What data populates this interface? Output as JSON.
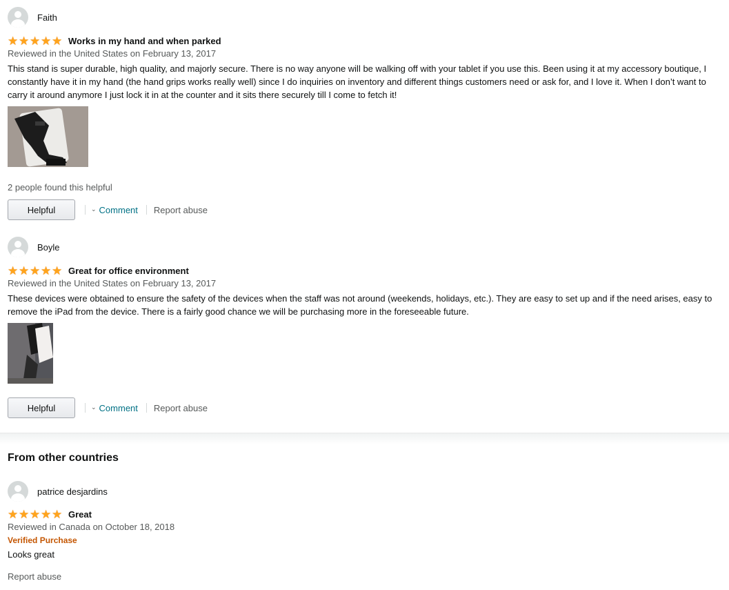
{
  "reviews": [
    {
      "name": "Faith",
      "rating": 5,
      "title": "Works in my hand and when parked",
      "date": "Reviewed in the United States on February 13, 2017",
      "body": "This stand is super durable, high quality, and majorly secure. There is no way anyone will be walking off with your tablet if you use this. Been using it at my accessory boutique, I constantly have it in my hand (the hand grips works really well) since I do inquiries on inventory and different things customers need or ask for, and I love it. When I don’t want to carry it around anymore I just lock it in at the counter and it sits there securely till I come to fetch it!",
      "helpful_count": "2 people found this helpful",
      "helpful_label": "Helpful",
      "comment_label": "Comment",
      "report_label": "Report abuse"
    },
    {
      "name": "Boyle",
      "rating": 5,
      "title": "Great for office environment",
      "date": "Reviewed in the United States on February 13, 2017",
      "body": "These devices were obtained to ensure the safety of the devices when the staff was not around (weekends, holidays, etc.). They are easy to set up and if the need arises, easy to remove the iPad from the device. There is a fairly good chance we will be purchasing more in the foreseeable future.",
      "helpful_label": "Helpful",
      "comment_label": "Comment",
      "report_label": "Report abuse"
    }
  ],
  "other_countries": {
    "heading": "From other countries",
    "review": {
      "name": "patrice desjardins",
      "rating": 5,
      "title": "Great",
      "date": "Reviewed in Canada on October 18, 2018",
      "verified": "Verified Purchase",
      "body": "Looks great",
      "report_label": "Report abuse"
    }
  },
  "colors": {
    "star": "#ffa41c",
    "link": "#007185",
    "verified": "#c45500",
    "muted": "#565959"
  }
}
